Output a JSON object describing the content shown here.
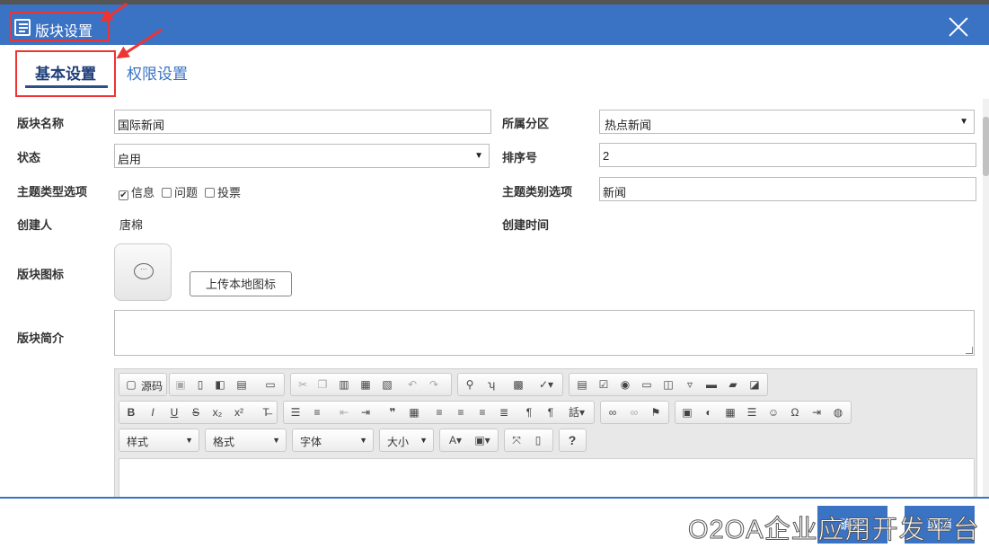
{
  "window": {
    "title": "版块设置"
  },
  "tabs": [
    {
      "label": "基本设置"
    },
    {
      "label": "权限设置"
    }
  ],
  "form": {
    "name_label": "版块名称",
    "name_value": "国际新闻",
    "section_label": "所属分区",
    "section_value": "热点新闻",
    "status_label": "状态",
    "status_value": "启用",
    "order_label": "排序号",
    "order_value": "2",
    "topic_type_label": "主题类型选项",
    "topic_types": [
      {
        "label": "信息",
        "checked": true
      },
      {
        "label": "问题",
        "checked": false
      },
      {
        "label": "投票",
        "checked": false
      }
    ],
    "topic_category_label": "主题类别选项",
    "topic_category_value": "新闻",
    "creator_label": "创建人",
    "creator_value": "唐棉",
    "created_time_label": "创建时间",
    "icon_label": "版块图标",
    "upload_label": "上传本地图标",
    "intro_label": "版块简介"
  },
  "editor": {
    "source_label": "源码",
    "styles_label": "样式",
    "format_label": "格式",
    "font_label": "字体",
    "size_label": "大小",
    "help_label": "?"
  },
  "footer": {
    "confirm_label": "确定",
    "cancel_label": "取消"
  },
  "watermark": "O2OA企业应用开发平台",
  "colors": {
    "titlebar": "#3a72c4",
    "highlight": "#e33333"
  }
}
